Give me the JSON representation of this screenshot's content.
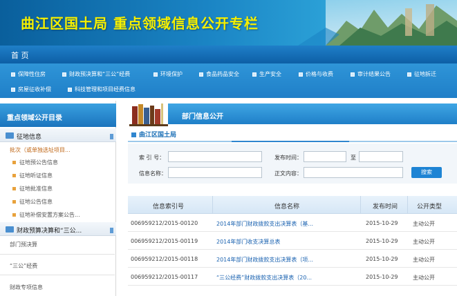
{
  "banner": {
    "title": "曲江区国土局  重点领域信息公开专栏"
  },
  "nav": {
    "home": "首 页"
  },
  "categories": [
    "保障性住房",
    "财政预决算和“三公”经费",
    "环境保护",
    "食品药品安全",
    "生产安全",
    "价格与收费",
    "审计结果公告",
    "征地拆迁",
    "房屋征收补偿",
    "科技管理和项目经费信息"
  ],
  "sidebar": {
    "title": "重点领域公开目录",
    "section1": "征地信息",
    "link1": "批次（或单独选址项目...",
    "subs": [
      "征地预公告信息",
      "征地听证信息",
      "征地批准信息",
      "征地公告信息",
      "征地补偿安置方案公告..."
    ],
    "section2": "财政预算决算和“三公...",
    "items": [
      "部门预决算",
      "“三公”经费",
      "财政专项信息"
    ]
  },
  "panel": {
    "title": "部门信息公开",
    "department": "曲江区国土局"
  },
  "search": {
    "index_label": "索 引 号：",
    "date_label": "发布时间：",
    "to_label": "至",
    "name_label": "信息名称：",
    "content_label": "正文内容：",
    "button": "搜索"
  },
  "table": {
    "headers": [
      "信息索引号",
      "信息名称",
      "发布时间",
      "公开类型"
    ],
    "rows": [
      {
        "code": "006959212/2015-00120",
        "name": "2014年部门财政拨款支出决算表（基...",
        "date": "2015-10-29",
        "type": "主动公开"
      },
      {
        "code": "006959212/2015-00119",
        "name": "2014年部门收支决算总表",
        "date": "2015-10-29",
        "type": "主动公开"
      },
      {
        "code": "006959212/2015-00118",
        "name": "2014年部门财政拨款支出决算表（项...",
        "date": "2015-10-29",
        "type": "主动公开"
      },
      {
        "code": "006959212/2015-00117",
        "name": "“三公经费”财政拨款支出决算表（20...",
        "date": "2015-10-29",
        "type": "主动公开"
      }
    ]
  },
  "colors": {
    "header_blue": "#1f7fc8",
    "title_yellow": "#f6f000",
    "link_blue": "#1a62b0",
    "link_orange": "#c06818"
  }
}
